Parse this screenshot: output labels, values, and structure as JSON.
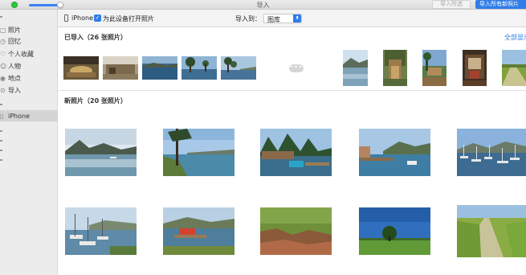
{
  "window": {
    "title": "导入"
  },
  "toolbar_buttons": {
    "import_selected": "导入所选",
    "import_all_new": "导入所有新照片"
  },
  "sidebar": {
    "items": [
      {
        "icon": "photos-icon",
        "label": "照片"
      },
      {
        "icon": "memories-icon",
        "label": "回忆"
      },
      {
        "icon": "for-you-icon",
        "label": "个人收藏"
      },
      {
        "icon": "people-icon",
        "label": "人物"
      },
      {
        "icon": "places-icon",
        "label": "地点"
      },
      {
        "icon": "import-icon",
        "label": "导入"
      }
    ],
    "device": {
      "icon": "iphone-icon",
      "label": "iPhone"
    }
  },
  "import_bar": {
    "device_name": "iPhone",
    "open_photos_checkbox": {
      "checked": true,
      "label": "为此设备打开照片"
    },
    "import_to_label": "导入到：",
    "import_to_value": "图库"
  },
  "imported_section": {
    "title": "已导入（26 张照片）",
    "show_all": "全部显示",
    "more_indicator": "•••"
  },
  "new_section": {
    "title": "新照片（20 张照片）"
  },
  "colors": {
    "accent": "#2f7de8",
    "sidebar_bg": "#ececec",
    "selected_bg": "#d4d4d4"
  }
}
